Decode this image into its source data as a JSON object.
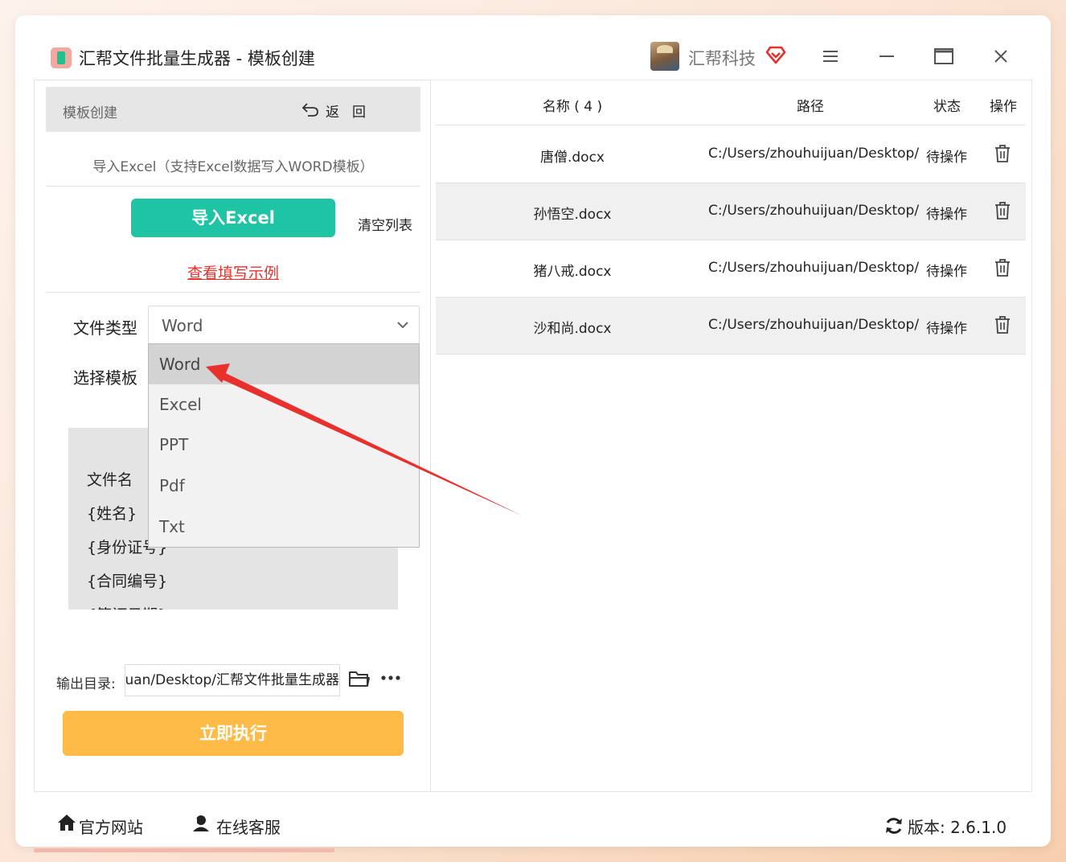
{
  "app": {
    "title": "汇帮文件批量生成器 - 模板创建",
    "company": "汇帮科技"
  },
  "left": {
    "header_title": "模板创建",
    "back_label": "返回",
    "import_hint": "导入Excel（支持Excel数据写入WORD模板）",
    "import_button": "导入Excel",
    "clear_button": "清空列表",
    "example_link": "查看填写示例",
    "filetype_label": "文件类型",
    "filetype_value": "Word",
    "filetype_options": [
      "Word",
      "Excel",
      "PPT",
      "Pdf",
      "Txt"
    ],
    "template_label": "选择模板",
    "template_fields": [
      "文件名",
      "{姓名}",
      "{身份证号}",
      "{合同编号}",
      "{签订日期}"
    ],
    "output_label": "输出目录:",
    "output_value": "uan/Desktop/汇帮文件批量生成器",
    "run_button": "立即执行"
  },
  "table": {
    "headers": {
      "name": "名称 ( 4 )",
      "path": "路径",
      "status": "状态",
      "action": "操作"
    },
    "rows": [
      {
        "name": "唐僧.docx",
        "path": "C:/Users/zhouhuijuan/Desktop/",
        "status": "待操作"
      },
      {
        "name": "孙悟空.docx",
        "path": "C:/Users/zhouhuijuan/Desktop/",
        "status": "待操作"
      },
      {
        "name": "猪八戒.docx",
        "path": "C:/Users/zhouhuijuan/Desktop/",
        "status": "待操作"
      },
      {
        "name": "沙和尚.docx",
        "path": "C:/Users/zhouhuijuan/Desktop/",
        "status": "待操作"
      }
    ]
  },
  "footer": {
    "website": "官方网站",
    "support": "在线客服",
    "version": "版本: 2.6.1.0"
  },
  "colors": {
    "accent_teal": "#1fc4a5",
    "accent_orange": "#ffbb47",
    "link_red": "#e8312d",
    "annotation_arrow": "#e8312d"
  },
  "icons": [
    "app-logo-icon",
    "vip-heart-icon",
    "menu-icon",
    "minimize-icon",
    "maximize-icon",
    "close-icon",
    "back-arrow-icon",
    "chevron-down-icon",
    "folder-icon",
    "more-icon",
    "trash-icon",
    "home-icon",
    "support-icon",
    "refresh-icon"
  ]
}
